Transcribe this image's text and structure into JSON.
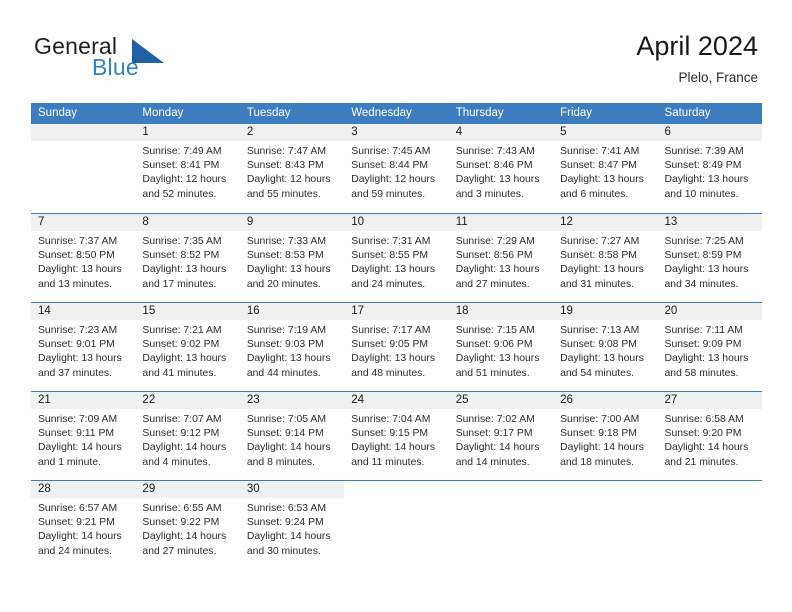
{
  "brand": {
    "word1": "General",
    "word2": "Blue",
    "mark_icon": "blue-triangle-flag-icon",
    "color_dark": "#231f20",
    "color_blue": "#2f84c8",
    "mark_color": "#1f5fa8"
  },
  "header": {
    "title": "April 2024",
    "subtitle": "Plelo, France"
  },
  "colors": {
    "header_blue": "#3c7cbf",
    "day_band_gray": "#f0f0f0",
    "text": "#2b2b2b"
  },
  "weekdays": [
    "Sunday",
    "Monday",
    "Tuesday",
    "Wednesday",
    "Thursday",
    "Friday",
    "Saturday"
  ],
  "weeks": [
    [
      {
        "day": "",
        "lines": [
          "",
          "",
          "",
          ""
        ],
        "empty": true
      },
      {
        "day": "1",
        "lines": [
          "Sunrise: 7:49 AM",
          "Sunset: 8:41 PM",
          "Daylight: 12 hours",
          "and 52 minutes."
        ]
      },
      {
        "day": "2",
        "lines": [
          "Sunrise: 7:47 AM",
          "Sunset: 8:43 PM",
          "Daylight: 12 hours",
          "and 55 minutes."
        ]
      },
      {
        "day": "3",
        "lines": [
          "Sunrise: 7:45 AM",
          "Sunset: 8:44 PM",
          "Daylight: 12 hours",
          "and 59 minutes."
        ]
      },
      {
        "day": "4",
        "lines": [
          "Sunrise: 7:43 AM",
          "Sunset: 8:46 PM",
          "Daylight: 13 hours",
          "and 3 minutes."
        ]
      },
      {
        "day": "5",
        "lines": [
          "Sunrise: 7:41 AM",
          "Sunset: 8:47 PM",
          "Daylight: 13 hours",
          "and 6 minutes."
        ]
      },
      {
        "day": "6",
        "lines": [
          "Sunrise: 7:39 AM",
          "Sunset: 8:49 PM",
          "Daylight: 13 hours",
          "and 10 minutes."
        ]
      }
    ],
    [
      {
        "day": "7",
        "lines": [
          "Sunrise: 7:37 AM",
          "Sunset: 8:50 PM",
          "Daylight: 13 hours",
          "and 13 minutes."
        ]
      },
      {
        "day": "8",
        "lines": [
          "Sunrise: 7:35 AM",
          "Sunset: 8:52 PM",
          "Daylight: 13 hours",
          "and 17 minutes."
        ]
      },
      {
        "day": "9",
        "lines": [
          "Sunrise: 7:33 AM",
          "Sunset: 8:53 PM",
          "Daylight: 13 hours",
          "and 20 minutes."
        ]
      },
      {
        "day": "10",
        "lines": [
          "Sunrise: 7:31 AM",
          "Sunset: 8:55 PM",
          "Daylight: 13 hours",
          "and 24 minutes."
        ]
      },
      {
        "day": "11",
        "lines": [
          "Sunrise: 7:29 AM",
          "Sunset: 8:56 PM",
          "Daylight: 13 hours",
          "and 27 minutes."
        ]
      },
      {
        "day": "12",
        "lines": [
          "Sunrise: 7:27 AM",
          "Sunset: 8:58 PM",
          "Daylight: 13 hours",
          "and 31 minutes."
        ]
      },
      {
        "day": "13",
        "lines": [
          "Sunrise: 7:25 AM",
          "Sunset: 8:59 PM",
          "Daylight: 13 hours",
          "and 34 minutes."
        ]
      }
    ],
    [
      {
        "day": "14",
        "lines": [
          "Sunrise: 7:23 AM",
          "Sunset: 9:01 PM",
          "Daylight: 13 hours",
          "and 37 minutes."
        ]
      },
      {
        "day": "15",
        "lines": [
          "Sunrise: 7:21 AM",
          "Sunset: 9:02 PM",
          "Daylight: 13 hours",
          "and 41 minutes."
        ]
      },
      {
        "day": "16",
        "lines": [
          "Sunrise: 7:19 AM",
          "Sunset: 9:03 PM",
          "Daylight: 13 hours",
          "and 44 minutes."
        ]
      },
      {
        "day": "17",
        "lines": [
          "Sunrise: 7:17 AM",
          "Sunset: 9:05 PM",
          "Daylight: 13 hours",
          "and 48 minutes."
        ]
      },
      {
        "day": "18",
        "lines": [
          "Sunrise: 7:15 AM",
          "Sunset: 9:06 PM",
          "Daylight: 13 hours",
          "and 51 minutes."
        ]
      },
      {
        "day": "19",
        "lines": [
          "Sunrise: 7:13 AM",
          "Sunset: 9:08 PM",
          "Daylight: 13 hours",
          "and 54 minutes."
        ]
      },
      {
        "day": "20",
        "lines": [
          "Sunrise: 7:11 AM",
          "Sunset: 9:09 PM",
          "Daylight: 13 hours",
          "and 58 minutes."
        ]
      }
    ],
    [
      {
        "day": "21",
        "lines": [
          "Sunrise: 7:09 AM",
          "Sunset: 9:11 PM",
          "Daylight: 14 hours",
          "and 1 minute."
        ]
      },
      {
        "day": "22",
        "lines": [
          "Sunrise: 7:07 AM",
          "Sunset: 9:12 PM",
          "Daylight: 14 hours",
          "and 4 minutes."
        ]
      },
      {
        "day": "23",
        "lines": [
          "Sunrise: 7:05 AM",
          "Sunset: 9:14 PM",
          "Daylight: 14 hours",
          "and 8 minutes."
        ]
      },
      {
        "day": "24",
        "lines": [
          "Sunrise: 7:04 AM",
          "Sunset: 9:15 PM",
          "Daylight: 14 hours",
          "and 11 minutes."
        ]
      },
      {
        "day": "25",
        "lines": [
          "Sunrise: 7:02 AM",
          "Sunset: 9:17 PM",
          "Daylight: 14 hours",
          "and 14 minutes."
        ]
      },
      {
        "day": "26",
        "lines": [
          "Sunrise: 7:00 AM",
          "Sunset: 9:18 PM",
          "Daylight: 14 hours",
          "and 18 minutes."
        ]
      },
      {
        "day": "27",
        "lines": [
          "Sunrise: 6:58 AM",
          "Sunset: 9:20 PM",
          "Daylight: 14 hours",
          "and 21 minutes."
        ]
      }
    ],
    [
      {
        "day": "28",
        "lines": [
          "Sunrise: 6:57 AM",
          "Sunset: 9:21 PM",
          "Daylight: 14 hours",
          "and 24 minutes."
        ]
      },
      {
        "day": "29",
        "lines": [
          "Sunrise: 6:55 AM",
          "Sunset: 9:22 PM",
          "Daylight: 14 hours",
          "and 27 minutes."
        ]
      },
      {
        "day": "30",
        "lines": [
          "Sunrise: 6:53 AM",
          "Sunset: 9:24 PM",
          "Daylight: 14 hours",
          "and 30 minutes."
        ]
      },
      {
        "day": "",
        "lines": [
          "",
          "",
          "",
          ""
        ],
        "empty": true,
        "noband": true
      },
      {
        "day": "",
        "lines": [
          "",
          "",
          "",
          ""
        ],
        "empty": true,
        "noband": true
      },
      {
        "day": "",
        "lines": [
          "",
          "",
          "",
          ""
        ],
        "empty": true,
        "noband": true
      },
      {
        "day": "",
        "lines": [
          "",
          "",
          "",
          ""
        ],
        "empty": true,
        "noband": true
      }
    ]
  ]
}
